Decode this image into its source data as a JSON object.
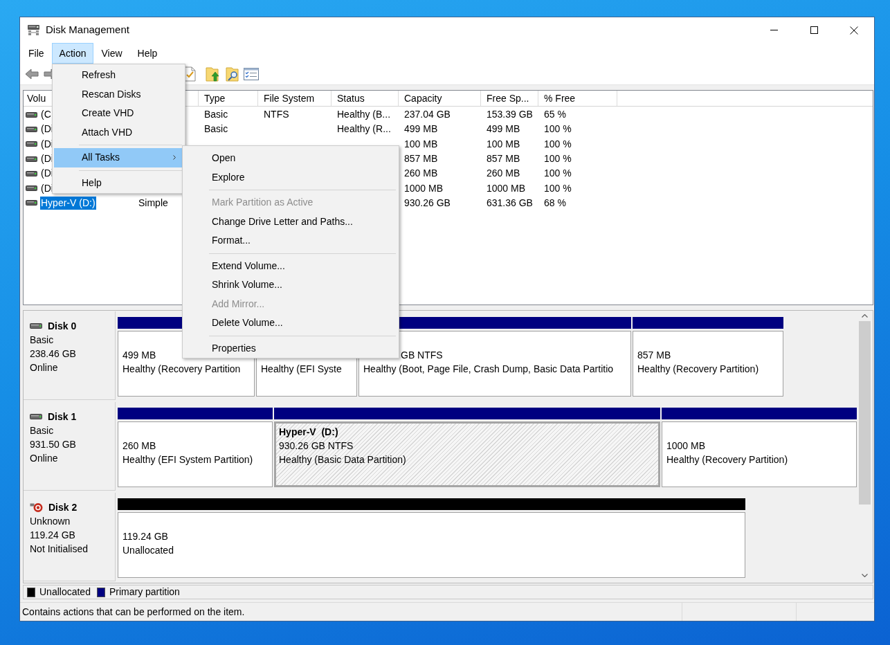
{
  "window": {
    "title": "Disk Management"
  },
  "menu_bar": [
    {
      "label": "File",
      "selected": false
    },
    {
      "label": "Action",
      "selected": true
    },
    {
      "label": "View",
      "selected": false
    },
    {
      "label": "Help",
      "selected": false
    }
  ],
  "action_menu": [
    {
      "kind": "item",
      "label": "Refresh",
      "selected": false
    },
    {
      "kind": "item",
      "label": "Rescan Disks",
      "selected": false
    },
    {
      "kind": "item",
      "label": "Create VHD",
      "selected": false
    },
    {
      "kind": "item",
      "label": "Attach VHD",
      "selected": false
    },
    {
      "kind": "separator"
    },
    {
      "kind": "submenu",
      "label": "All Tasks",
      "selected": true
    },
    {
      "kind": "separator"
    },
    {
      "kind": "item",
      "label": "Help",
      "selected": false
    }
  ],
  "all_tasks_menu": [
    {
      "kind": "item",
      "label": "Open",
      "disabled": false
    },
    {
      "kind": "item",
      "label": "Explore",
      "disabled": false
    },
    {
      "kind": "separator"
    },
    {
      "kind": "item",
      "label": "Mark Partition as Active",
      "disabled": true
    },
    {
      "kind": "item",
      "label": "Change Drive Letter and Paths...",
      "disabled": false
    },
    {
      "kind": "item",
      "label": "Format...",
      "disabled": false
    },
    {
      "kind": "separator"
    },
    {
      "kind": "item",
      "label": "Extend Volume...",
      "disabled": false
    },
    {
      "kind": "item",
      "label": "Shrink Volume...",
      "disabled": false
    },
    {
      "kind": "item",
      "label": "Add Mirror...",
      "disabled": true
    },
    {
      "kind": "item",
      "label": "Delete Volume...",
      "disabled": false
    },
    {
      "kind": "separator"
    },
    {
      "kind": "item",
      "label": "Properties",
      "disabled": false
    }
  ],
  "volume_list": {
    "columns": [
      {
        "label": "Volu"
      },
      {
        "label": "Type"
      },
      {
        "label": "File System"
      },
      {
        "label": "Status"
      },
      {
        "label": "Capacity"
      },
      {
        "label": "Free Sp..."
      },
      {
        "label": "% Free"
      }
    ],
    "rows": [
      {
        "volume": "(C",
        "type": "Basic",
        "file_system": "NTFS",
        "status": "Healthy (B...",
        "capacity": "237.04 GB",
        "free_space": "153.39 GB",
        "percent_free": "65 %",
        "selected": false
      },
      {
        "volume": "(Di",
        "type": "Basic",
        "status": "Healthy (R...",
        "capacity": "499 MB",
        "free_space": "499 MB",
        "percent_free": "100 %",
        "selected": false
      },
      {
        "volume": "(Di",
        "capacity": "100 MB",
        "free_space": "100 MB",
        "percent_free": "100 %",
        "selected": false
      },
      {
        "volume": "(Di",
        "capacity": "857 MB",
        "free_space": "857 MB",
        "percent_free": "100 %",
        "selected": false
      },
      {
        "volume": "(Di",
        "capacity": "260 MB",
        "free_space": "260 MB",
        "percent_free": "100 %",
        "selected": false
      },
      {
        "volume": "(Di",
        "capacity": "1000 MB",
        "free_space": "1000 MB",
        "percent_free": "100 %",
        "selected": false
      },
      {
        "volume": "Hyper-V (D:)",
        "layout": "Simple",
        "capacity": "930.26 GB",
        "free_space": "631.36 GB",
        "percent_free": "68 %",
        "selected": true
      }
    ]
  },
  "disk_map": {
    "disks": [
      {
        "name": "Disk 0",
        "kind": "drive",
        "type": "Basic",
        "size": "238.46 GB",
        "status": "Online",
        "partitions": [
          {
            "kind": "primary",
            "size": "499 MB",
            "status": "Healthy (Recovery Partition",
            "selected": false
          },
          {
            "kind": "primary",
            "status": "Healthy (EFI Syste",
            "selected": false
          },
          {
            "kind": "primary",
            "size": "GB NTFS",
            "status": "Healthy (Boot, Page File, Crash Dump, Basic Data Partitio",
            "selected": false
          },
          {
            "kind": "primary",
            "size": "857 MB",
            "status": "Healthy (Recovery Partition)",
            "selected": false
          }
        ]
      },
      {
        "name": "Disk 1",
        "kind": "drive",
        "type": "Basic",
        "size": "931.50 GB",
        "status": "Online",
        "partitions": [
          {
            "kind": "primary",
            "size": "260 MB",
            "status": "Healthy (EFI System Partition)",
            "selected": false
          },
          {
            "kind": "primary",
            "label": "Hyper-V  (D:)",
            "size": "930.26 GB NTFS",
            "status": "Healthy (Basic Data Partition)",
            "selected": true
          },
          {
            "kind": "primary",
            "size": "1000 MB",
            "status": "Healthy (Recovery Partition)",
            "selected": false
          }
        ]
      },
      {
        "name": "Disk 2",
        "kind": "error",
        "type": "Unknown",
        "size": "119.24 GB",
        "status": "Not Initialised",
        "partitions": [
          {
            "kind": "unallocated",
            "size": "119.24 GB",
            "status": "Unallocated",
            "selected": false
          }
        ]
      }
    ],
    "legend": [
      {
        "label": "Unallocated",
        "color": "#000000"
      },
      {
        "label": "Primary partition",
        "color": "#000080"
      }
    ]
  },
  "status_bar": {
    "text": "Contains actions that can be performed on the item."
  }
}
